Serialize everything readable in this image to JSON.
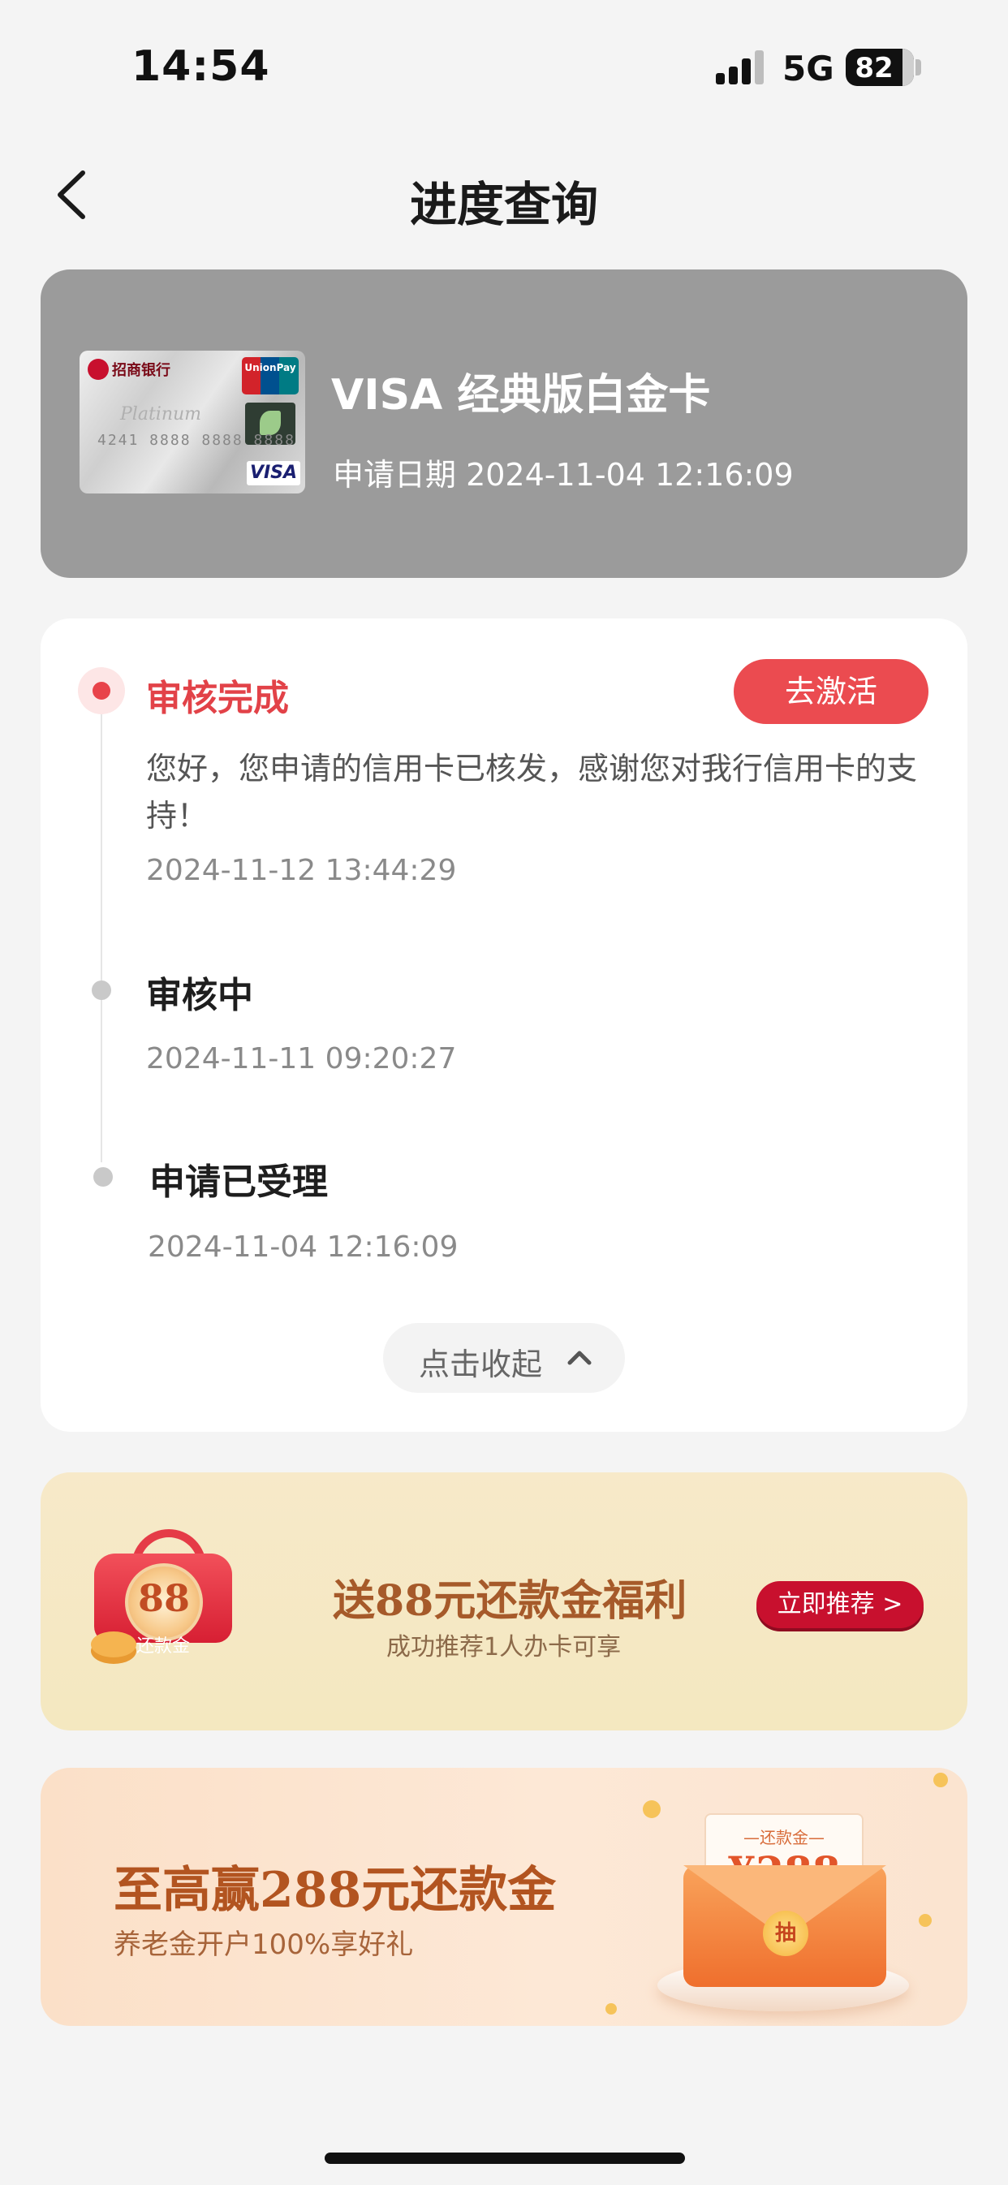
{
  "status_bar": {
    "time": "14:54",
    "network": "5G",
    "battery": "82"
  },
  "nav": {
    "title": "进度查询",
    "back_icon": "chevron-left-icon"
  },
  "card": {
    "name": "VISA 经典版白金卡",
    "apply_date": "申请日期 2024-11-04 12:16:09",
    "image_texts": {
      "bank": "招商银行",
      "unionpay": "UnionPay",
      "visa": "VISA",
      "script": "Platinum",
      "number": "4241 8888 8888 8888"
    }
  },
  "progress": {
    "steps": [
      {
        "title": "审核完成",
        "description": "您好，您申请的信用卡已核发，感谢您对我行信用卡的支持！",
        "time": "2024-11-12 13:44:29",
        "status": "done"
      },
      {
        "title": "审核中",
        "time": "2024-11-11 09:20:27",
        "status": "past"
      },
      {
        "title": "申请已受理",
        "time": "2024-11-04 12:16:09",
        "status": "past"
      }
    ],
    "activate_label": "去激活",
    "collapse_label": "点击收起",
    "accent_color": "#e8434a"
  },
  "banner1": {
    "title": "送88元还款金福利",
    "subtitle": "成功推荐1人办卡可享",
    "badge_amount": "88",
    "badge_label": "还款金",
    "button_label": "立即推荐 >"
  },
  "banner2": {
    "title": "至高赢288元还款金",
    "subtitle": "养老金开户100%享好礼",
    "envelope_tag": "—还款金—",
    "envelope_amount": "¥288",
    "seal_label": "抽"
  }
}
